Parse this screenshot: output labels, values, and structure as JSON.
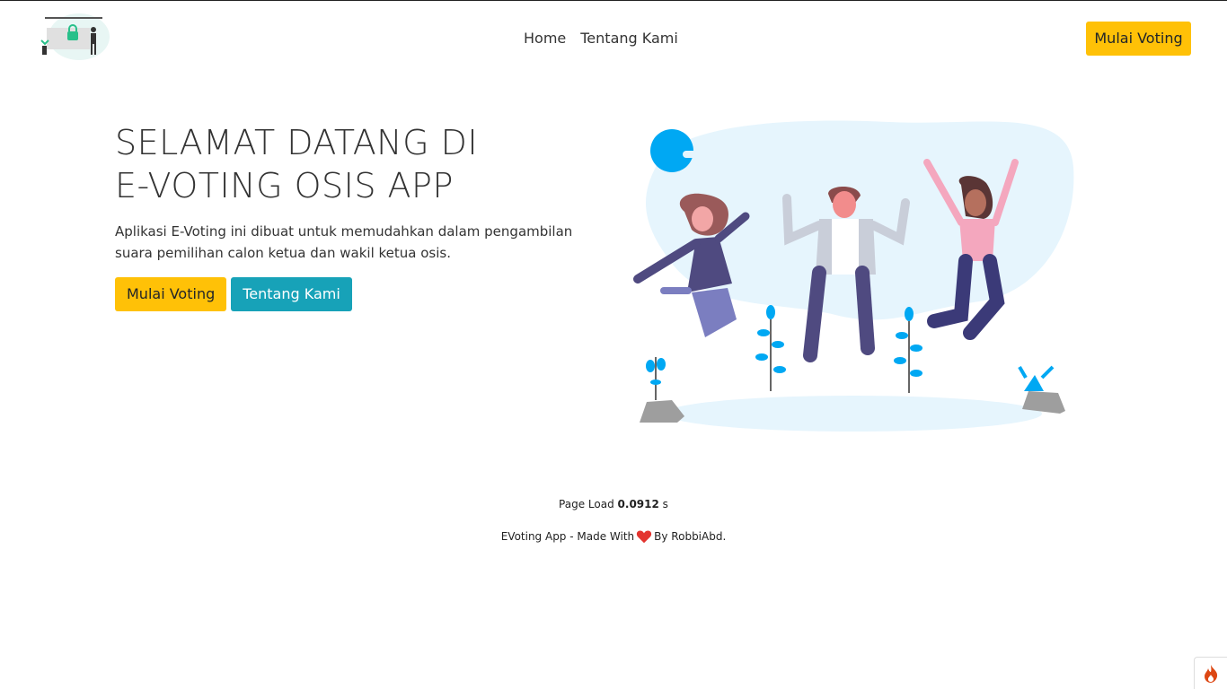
{
  "nav": {
    "links": [
      "Home",
      "Tentang Kami"
    ],
    "cta_label": "Mulai Voting"
  },
  "hero": {
    "title_line1": "SELAMAT DATANG DI",
    "title_line2": "E-VOTING OSIS APP",
    "description": "Aplikasi E-Voting ini dibuat untuk memudahkan dalam pengambilan suara pemilihan calon ketua dan wakil ketua osis.",
    "primary_button": "Mulai Voting",
    "secondary_button": "Tentang Kami"
  },
  "footer": {
    "page_load_label": "Page Load",
    "page_load_value": "0.0912",
    "page_load_unit": "s",
    "credit_prefix": "EVoting App - Made With",
    "credit_suffix": "By RobbiAbd."
  },
  "colors": {
    "warning": "#ffc107",
    "info": "#17a2b8",
    "heart": "#e3342f",
    "illustration_blue": "#00a8f3",
    "illustration_bg": "#e6f5fd"
  },
  "icons": {
    "logo": "voting-illustration-logo",
    "heart": "heart-icon",
    "debug": "flame-icon"
  }
}
